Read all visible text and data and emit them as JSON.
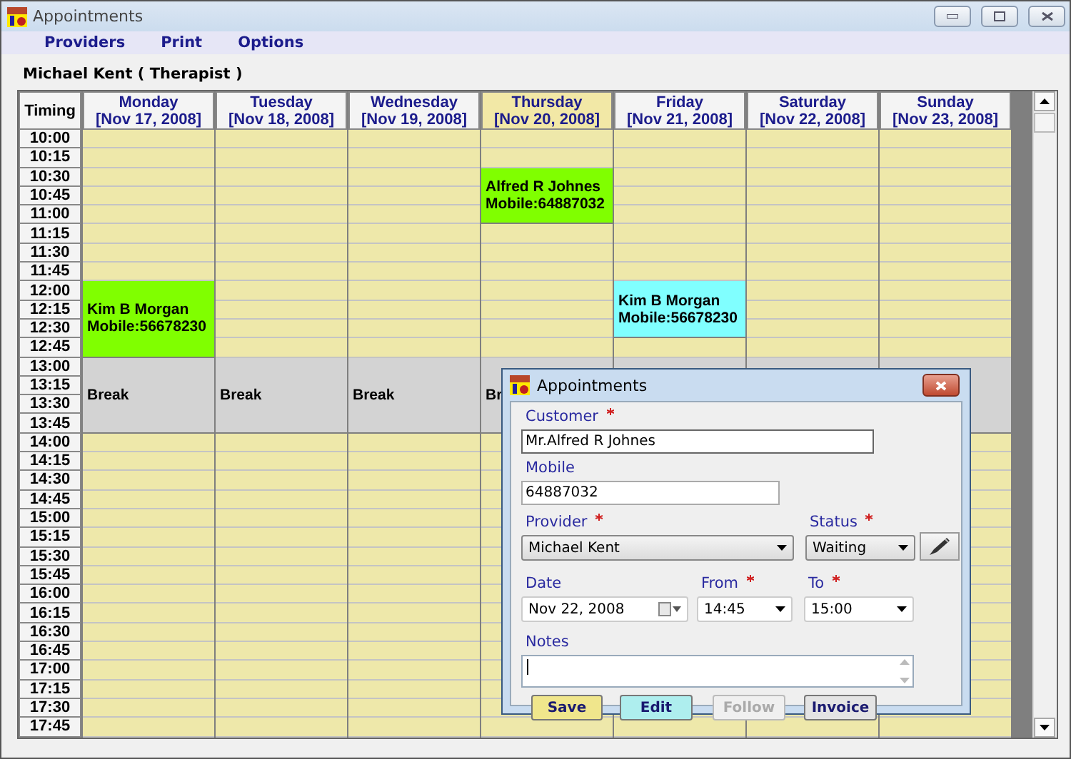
{
  "window": {
    "title": "Appointments"
  },
  "menu": [
    "Providers",
    "Print",
    "Options"
  ],
  "provider_heading": "Michael Kent ( Therapist )",
  "schedule": {
    "timing_heading": "Timing",
    "days": [
      {
        "name": "Monday",
        "date": "[Nov 17, 2008]",
        "selected": false
      },
      {
        "name": "Tuesday",
        "date": "[Nov 18, 2008]",
        "selected": false
      },
      {
        "name": "Wednesday",
        "date": "[Nov 19, 2008]",
        "selected": false
      },
      {
        "name": "Thursday",
        "date": "[Nov 20, 2008]",
        "selected": true
      },
      {
        "name": "Friday",
        "date": "[Nov 21, 2008]",
        "selected": false
      },
      {
        "name": "Saturday",
        "date": "[Nov 22, 2008]",
        "selected": false
      },
      {
        "name": "Sunday",
        "date": "[Nov 23, 2008]",
        "selected": false
      }
    ],
    "rows": [
      {
        "time": "10:00",
        "cells": [
          {
            "kind": "free"
          },
          {
            "kind": "free"
          },
          {
            "kind": "free"
          },
          {
            "kind": "free"
          },
          {
            "kind": "free"
          },
          {
            "kind": "free"
          },
          {
            "kind": "free"
          }
        ]
      },
      {
        "time": "10:15",
        "cells": [
          {
            "kind": "free"
          },
          {
            "kind": "free"
          },
          {
            "kind": "free"
          },
          {
            "kind": "free"
          },
          {
            "kind": "free"
          },
          {
            "kind": "free"
          },
          {
            "kind": "free"
          }
        ]
      },
      {
        "time": "10:30",
        "cells": [
          {
            "kind": "free"
          },
          {
            "kind": "free"
          },
          {
            "kind": "free"
          },
          {
            "kind": "appointment",
            "name": "Alfred R Johnes",
            "mobile": "Mobile:64887032",
            "color": "#80ff00"
          },
          {
            "kind": "free"
          },
          {
            "kind": "free"
          },
          {
            "kind": "free"
          }
        ]
      },
      {
        "time": "10:45",
        "cells": [
          {
            "kind": "free"
          },
          {
            "kind": "free"
          },
          {
            "kind": "free"
          },
          {
            "kind": "more"
          },
          {
            "kind": "free"
          },
          {
            "kind": "free"
          },
          {
            "kind": "free"
          }
        ]
      },
      {
        "time": "11:00",
        "cells": [
          {
            "kind": "free"
          },
          {
            "kind": "free"
          },
          {
            "kind": "free"
          },
          {
            "kind": "more"
          },
          {
            "kind": "free"
          },
          {
            "kind": "free"
          },
          {
            "kind": "free"
          }
        ]
      },
      {
        "time": "11:15",
        "cells": [
          {
            "kind": "free"
          },
          {
            "kind": "free"
          },
          {
            "kind": "free"
          },
          {
            "kind": "free"
          },
          {
            "kind": "free"
          },
          {
            "kind": "free"
          },
          {
            "kind": "free"
          }
        ]
      },
      {
        "time": "11:30",
        "cells": [
          {
            "kind": "free"
          },
          {
            "kind": "free"
          },
          {
            "kind": "free"
          },
          {
            "kind": "free"
          },
          {
            "kind": "free"
          },
          {
            "kind": "free"
          },
          {
            "kind": "free"
          }
        ]
      },
      {
        "time": "11:45",
        "cells": [
          {
            "kind": "free"
          },
          {
            "kind": "free"
          },
          {
            "kind": "free"
          },
          {
            "kind": "free"
          },
          {
            "kind": "free"
          },
          {
            "kind": "free"
          },
          {
            "kind": "free"
          }
        ]
      },
      {
        "time": "12:00",
        "cells": [
          {
            "kind": "appointment",
            "name": "Kim B Morgan",
            "mobile": "Mobile:56678230",
            "color": "#80ff00"
          },
          {
            "kind": "free"
          },
          {
            "kind": "free"
          },
          {
            "kind": "free"
          },
          {
            "kind": "appointment",
            "name": "Kim B Morgan",
            "mobile": "Mobile:56678230",
            "color": "#80ffff"
          },
          {
            "kind": "free"
          },
          {
            "kind": "free"
          }
        ]
      },
      {
        "time": "12:15",
        "cells": [
          {
            "kind": "more"
          },
          {
            "kind": "free"
          },
          {
            "kind": "free"
          },
          {
            "kind": "free"
          },
          {
            "kind": "more"
          },
          {
            "kind": "free"
          },
          {
            "kind": "free"
          }
        ]
      },
      {
        "time": "12:30",
        "cells": [
          {
            "kind": "more"
          },
          {
            "kind": "free"
          },
          {
            "kind": "free"
          },
          {
            "kind": "free"
          },
          {
            "kind": "more"
          },
          {
            "kind": "free"
          },
          {
            "kind": "free"
          }
        ]
      },
      {
        "time": "12:45",
        "cells": [
          {
            "kind": "more"
          },
          {
            "kind": "free"
          },
          {
            "kind": "free"
          },
          {
            "kind": "free"
          },
          {
            "kind": "free"
          },
          {
            "kind": "free"
          },
          {
            "kind": "free"
          }
        ]
      },
      {
        "time": "13:00",
        "cells": [
          {
            "kind": "break",
            "label": "Break"
          },
          {
            "kind": "break",
            "label": "Break"
          },
          {
            "kind": "break",
            "label": "Break"
          },
          {
            "kind": "break",
            "label": "Br"
          },
          {
            "kind": "break"
          },
          {
            "kind": "break"
          },
          {
            "kind": "break"
          }
        ]
      },
      {
        "time": "13:15",
        "cells": [
          {
            "kind": "more"
          },
          {
            "kind": "more"
          },
          {
            "kind": "more"
          },
          {
            "kind": "more"
          },
          {
            "kind": "more"
          },
          {
            "kind": "more"
          },
          {
            "kind": "more"
          }
        ]
      },
      {
        "time": "13:30",
        "cells": [
          {
            "kind": "more"
          },
          {
            "kind": "more"
          },
          {
            "kind": "more"
          },
          {
            "kind": "more"
          },
          {
            "kind": "more"
          },
          {
            "kind": "more"
          },
          {
            "kind": "more"
          }
        ]
      },
      {
        "time": "13:45",
        "cells": [
          {
            "kind": "more"
          },
          {
            "kind": "more"
          },
          {
            "kind": "more"
          },
          {
            "kind": "more"
          },
          {
            "kind": "more"
          },
          {
            "kind": "more"
          },
          {
            "kind": "more"
          }
        ]
      },
      {
        "time": "14:00",
        "cells": [
          {
            "kind": "free"
          },
          {
            "kind": "free"
          },
          {
            "kind": "free"
          },
          {
            "kind": "free"
          },
          {
            "kind": "covered"
          },
          {
            "kind": "free"
          },
          {
            "kind": "free"
          }
        ]
      },
      {
        "time": "14:15",
        "cells": [
          {
            "kind": "free"
          },
          {
            "kind": "free"
          },
          {
            "kind": "free"
          },
          {
            "kind": "free"
          },
          {
            "kind": "covered"
          },
          {
            "kind": "free"
          },
          {
            "kind": "free"
          }
        ]
      },
      {
        "time": "14:30",
        "cells": [
          {
            "kind": "free"
          },
          {
            "kind": "free"
          },
          {
            "kind": "free"
          },
          {
            "kind": "free"
          },
          {
            "kind": "covered"
          },
          {
            "kind": "free"
          },
          {
            "kind": "free"
          }
        ]
      },
      {
        "time": "14:45",
        "cells": [
          {
            "kind": "free"
          },
          {
            "kind": "free"
          },
          {
            "kind": "free"
          },
          {
            "kind": "free"
          },
          {
            "kind": "covered"
          },
          {
            "kind": "free"
          },
          {
            "kind": "free"
          }
        ]
      },
      {
        "time": "15:00",
        "cells": [
          {
            "kind": "free"
          },
          {
            "kind": "free"
          },
          {
            "kind": "free"
          },
          {
            "kind": "free"
          },
          {
            "kind": "free"
          },
          {
            "kind": "free"
          },
          {
            "kind": "free"
          }
        ]
      },
      {
        "time": "15:15",
        "cells": [
          {
            "kind": "free"
          },
          {
            "kind": "free"
          },
          {
            "kind": "free"
          },
          {
            "kind": "free"
          },
          {
            "kind": "free"
          },
          {
            "kind": "free"
          },
          {
            "kind": "free"
          }
        ]
      },
      {
        "time": "15:30",
        "cells": [
          {
            "kind": "free"
          },
          {
            "kind": "free"
          },
          {
            "kind": "free"
          },
          {
            "kind": "free"
          },
          {
            "kind": "free"
          },
          {
            "kind": "free"
          },
          {
            "kind": "free"
          }
        ]
      },
      {
        "time": "15:45",
        "cells": [
          {
            "kind": "free"
          },
          {
            "kind": "free"
          },
          {
            "kind": "free"
          },
          {
            "kind": "free"
          },
          {
            "kind": "free"
          },
          {
            "kind": "free"
          },
          {
            "kind": "free"
          }
        ]
      },
      {
        "time": "16:00",
        "cells": [
          {
            "kind": "free"
          },
          {
            "kind": "free"
          },
          {
            "kind": "free"
          },
          {
            "kind": "free"
          },
          {
            "kind": "free"
          },
          {
            "kind": "free"
          },
          {
            "kind": "free"
          }
        ]
      },
      {
        "time": "16:15",
        "cells": [
          {
            "kind": "free"
          },
          {
            "kind": "free"
          },
          {
            "kind": "free"
          },
          {
            "kind": "free"
          },
          {
            "kind": "free"
          },
          {
            "kind": "free"
          },
          {
            "kind": "free"
          }
        ]
      },
      {
        "time": "16:30",
        "cells": [
          {
            "kind": "free"
          },
          {
            "kind": "free"
          },
          {
            "kind": "free"
          },
          {
            "kind": "free"
          },
          {
            "kind": "free"
          },
          {
            "kind": "free"
          },
          {
            "kind": "free"
          }
        ]
      },
      {
        "time": "16:45",
        "cells": [
          {
            "kind": "free"
          },
          {
            "kind": "free"
          },
          {
            "kind": "free"
          },
          {
            "kind": "free"
          },
          {
            "kind": "free"
          },
          {
            "kind": "free"
          },
          {
            "kind": "free"
          }
        ]
      },
      {
        "time": "17:00",
        "cells": [
          {
            "kind": "free"
          },
          {
            "kind": "free"
          },
          {
            "kind": "free"
          },
          {
            "kind": "free"
          },
          {
            "kind": "free"
          },
          {
            "kind": "free"
          },
          {
            "kind": "free"
          }
        ]
      },
      {
        "time": "17:15",
        "cells": [
          {
            "kind": "free"
          },
          {
            "kind": "free"
          },
          {
            "kind": "free"
          },
          {
            "kind": "free"
          },
          {
            "kind": "free"
          },
          {
            "kind": "free"
          },
          {
            "kind": "free"
          }
        ]
      },
      {
        "time": "17:30",
        "cells": [
          {
            "kind": "free"
          },
          {
            "kind": "free"
          },
          {
            "kind": "free"
          },
          {
            "kind": "free"
          },
          {
            "kind": "free"
          },
          {
            "kind": "free"
          },
          {
            "kind": "free"
          }
        ]
      },
      {
        "time": "17:45",
        "cells": [
          {
            "kind": "free"
          },
          {
            "kind": "free"
          },
          {
            "kind": "free"
          },
          {
            "kind": "free"
          },
          {
            "kind": "free"
          },
          {
            "kind": "free"
          },
          {
            "kind": "free"
          }
        ]
      }
    ]
  },
  "dialog": {
    "title": "Appointments",
    "customer": {
      "label": "Customer",
      "required": true,
      "value": "Mr.Alfred R Johnes"
    },
    "mobile": {
      "label": "Mobile",
      "required": false,
      "value": "64887032"
    },
    "provider": {
      "label": "Provider",
      "required": true,
      "value": "Michael Kent"
    },
    "status": {
      "label": "Status",
      "required": true,
      "value": "Waiting"
    },
    "date": {
      "label": "Date",
      "required": false,
      "value": "Nov 22, 2008"
    },
    "from": {
      "label": "From",
      "required": true,
      "value": "14:45"
    },
    "to": {
      "label": "To",
      "required": true,
      "value": "15:00"
    },
    "notes": {
      "label": "Notes",
      "required": false,
      "focused": true
    },
    "buttons": [
      {
        "label": "Save",
        "color": "#f0e68c",
        "disabled": false
      },
      {
        "label": "Edit",
        "color": "#aeeeee",
        "disabled": false
      },
      {
        "label": "Follow",
        "color": "#f0f0f0",
        "disabled": true
      },
      {
        "label": "Invoice",
        "color": "#e4e4e4",
        "disabled": false
      }
    ]
  }
}
